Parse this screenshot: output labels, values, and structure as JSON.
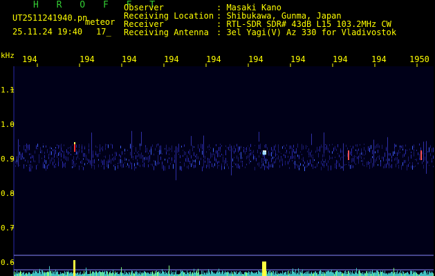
{
  "header": {
    "station": "H R O F F T",
    "filename": "UT2511241940.pn",
    "type_label": "meteor",
    "datetime": "25.11.24 19:40",
    "count": "17_",
    "info_labels": [
      "Observer",
      "Receiving Location",
      "Receiver",
      "Receiving Antenna"
    ],
    "info_values": [
      ": Masaki Kano",
      ": Shibukawa, Gunma, Japan",
      ": RTL-SDR SDR# 43dB L15 103.2MHz CW",
      ": 3el Yagi(V) Az 330 for Vladivostok"
    ]
  },
  "axis": {
    "unit": "kHz",
    "y_ticks": [
      "1.1",
      "1.0",
      "0.9",
      "0.8",
      "0.7",
      "0.6"
    ],
    "x_ticks": [
      "194",
      "194",
      "194",
      "194",
      "194",
      "194",
      "194",
      "194",
      "194",
      "1950"
    ]
  },
  "colors": {
    "text": "#ffff00",
    "title": "#33cc33",
    "background": "#000000",
    "plot_bg": "#000018",
    "grid": "#5c5cff"
  }
}
